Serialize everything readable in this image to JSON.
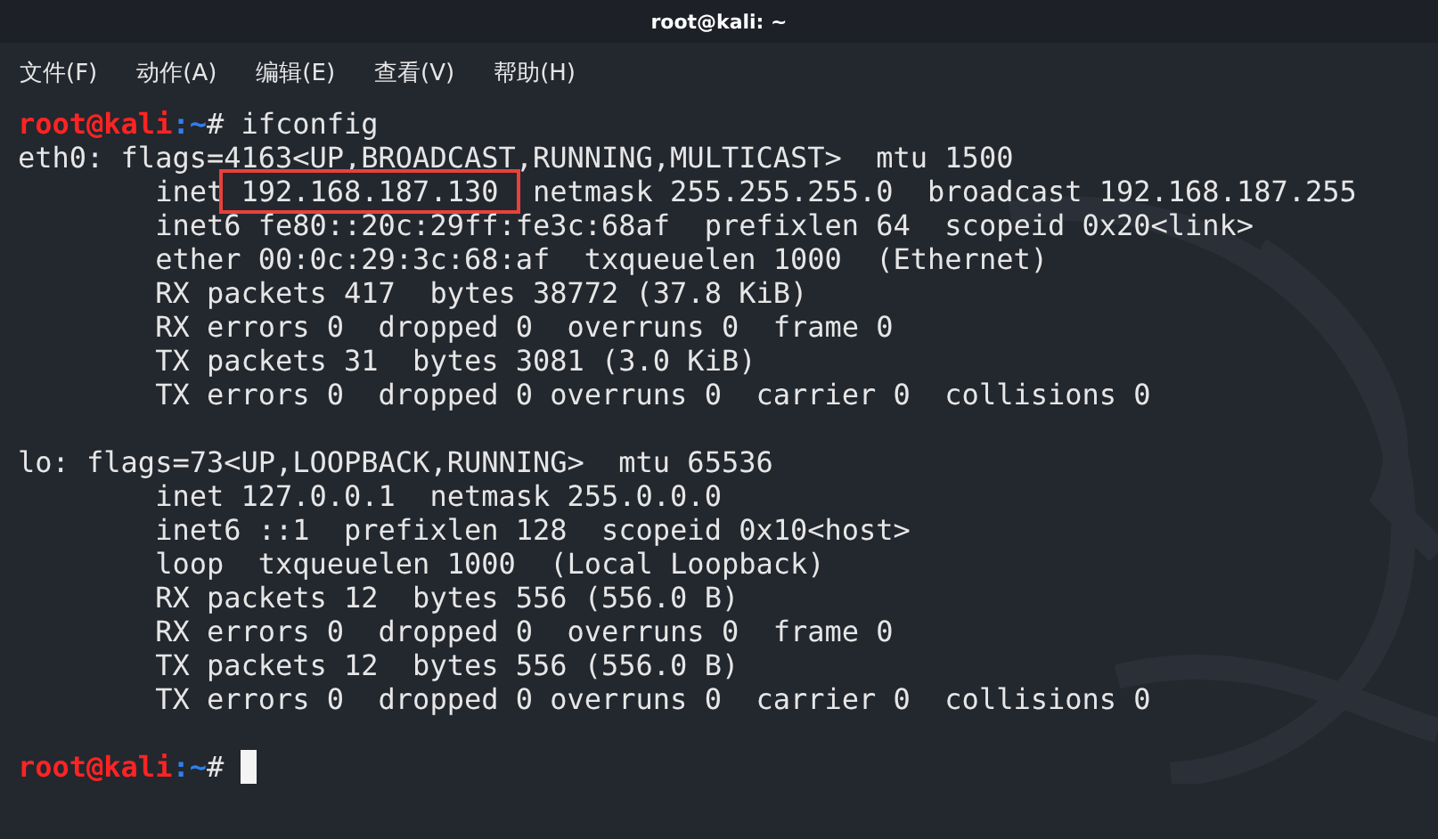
{
  "window": {
    "title": "root@kali: ~"
  },
  "menu": [
    "文件(F)",
    "动作(A)",
    "编辑(E)",
    "查看(V)",
    "帮助(H)"
  ],
  "terminal": {
    "blocks": [
      [
        {
          "segments": [
            {
              "text": "root@kali",
              "kind": "user"
            },
            {
              "text": ":~",
              "kind": "path"
            },
            {
              "text": "# ifconfig",
              "kind": "plain"
            }
          ]
        },
        {
          "segments": [
            {
              "text": "eth0: flags=4163<UP,BROADCAST,RUNNING,MULTICAST>  mtu 1500",
              "kind": "plain"
            }
          ]
        },
        {
          "segments": [
            {
              "text": "        inet",
              "kind": "plain"
            },
            {
              "text": " 192.168.187.130 ",
              "kind": "highlight"
            },
            {
              "text": " netmask 255.255.255.0  broadcast 192.168.187.255",
              "kind": "plain"
            }
          ]
        },
        {
          "segments": [
            {
              "text": "        inet6 fe80::20c:29ff:fe3c:68af  prefixlen 64  scopeid 0x20<link>",
              "kind": "plain"
            }
          ]
        },
        {
          "segments": [
            {
              "text": "        ether 00:0c:29:3c:68:af  txqueuelen 1000  (Ethernet)",
              "kind": "plain"
            }
          ]
        },
        {
          "segments": [
            {
              "text": "        RX packets 417  bytes 38772 (37.8 KiB)",
              "kind": "plain"
            }
          ]
        },
        {
          "segments": [
            {
              "text": "        RX errors 0  dropped 0  overruns 0  frame 0",
              "kind": "plain"
            }
          ]
        },
        {
          "segments": [
            {
              "text": "        TX packets 31  bytes 3081 (3.0 KiB)",
              "kind": "plain"
            }
          ]
        },
        {
          "segments": [
            {
              "text": "        TX errors 0  dropped 0 overruns 0  carrier 0  collisions 0",
              "kind": "plain"
            }
          ]
        }
      ],
      [
        {
          "segments": [
            {
              "text": "lo: flags=73<UP,LOOPBACK,RUNNING>  mtu 65536",
              "kind": "plain"
            }
          ]
        },
        {
          "segments": [
            {
              "text": "        inet 127.0.0.1  netmask 255.0.0.0",
              "kind": "plain"
            }
          ]
        },
        {
          "segments": [
            {
              "text": "        inet6 ::1  prefixlen 128  scopeid 0x10<host>",
              "kind": "plain"
            }
          ]
        },
        {
          "segments": [
            {
              "text": "        loop  txqueuelen 1000  (Local Loopback)",
              "kind": "plain"
            }
          ]
        },
        {
          "segments": [
            {
              "text": "        RX packets 12  bytes 556 (556.0 B)",
              "kind": "plain"
            }
          ]
        },
        {
          "segments": [
            {
              "text": "        RX errors 0  dropped 0  overruns 0  frame 0",
              "kind": "plain"
            }
          ]
        },
        {
          "segments": [
            {
              "text": "        TX packets 12  bytes 556 (556.0 B)",
              "kind": "plain"
            }
          ]
        },
        {
          "segments": [
            {
              "text": "        TX errors 0  dropped 0 overruns 0  carrier 0  collisions 0",
              "kind": "plain"
            }
          ]
        }
      ],
      [
        {
          "segments": [
            {
              "text": "root@kali",
              "kind": "user"
            },
            {
              "text": ":~",
              "kind": "path"
            },
            {
              "text": "# ",
              "kind": "plain"
            }
          ],
          "cursor": true
        }
      ]
    ]
  }
}
